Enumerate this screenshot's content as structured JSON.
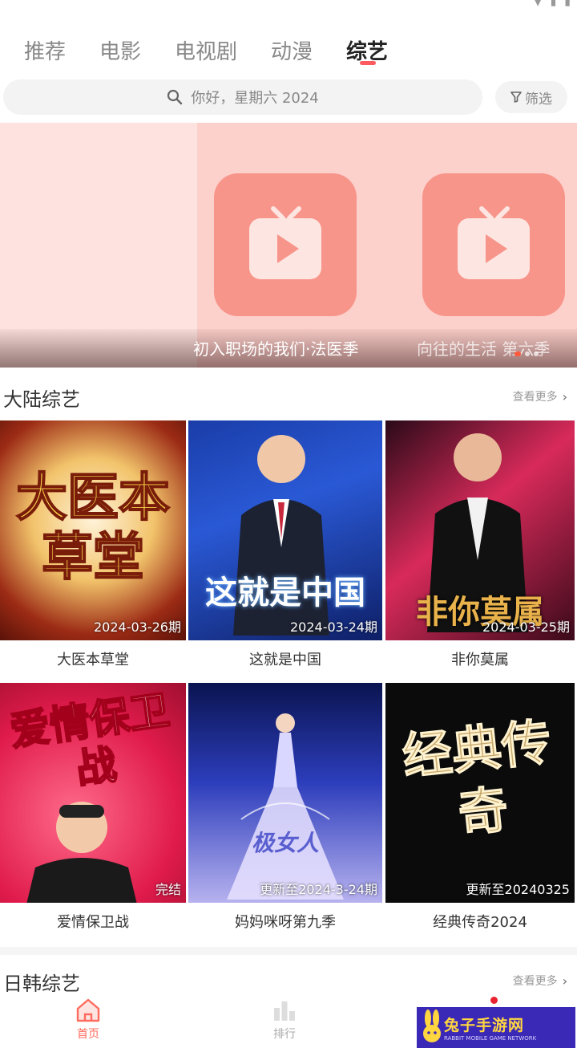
{
  "tabs": [
    {
      "label": "推荐"
    },
    {
      "label": "电影"
    },
    {
      "label": "电视剧"
    },
    {
      "label": "动漫"
    },
    {
      "label": "综艺",
      "active": true
    }
  ],
  "search": {
    "placeholder": "你好，星期六 2024"
  },
  "filter": {
    "label": "筛选"
  },
  "banner": {
    "captions": [
      "初入职场的我们·法医季",
      "向往的生活 第六季"
    ]
  },
  "sections": [
    {
      "title": "大陆综艺",
      "more": "查看更多",
      "items": [
        {
          "name": "大医本草堂",
          "poster_text": "大医本草堂",
          "tag": "2024-03-26期"
        },
        {
          "name": "这就是中国",
          "poster_text": "这就是中国",
          "tag": "2024-03-24期"
        },
        {
          "name": "非你莫属",
          "poster_text": "非你莫属",
          "tag": "2024-03-25期"
        },
        {
          "name": "爱情保卫战",
          "poster_text": "爱情保卫战",
          "tag": "完结"
        },
        {
          "name": "妈妈咪呀第九季",
          "poster_text": "极女人",
          "tag": "更新至2024-3-24期"
        },
        {
          "name": "经典传奇2024",
          "poster_text": "经典传奇",
          "tag": "更新至20240325"
        }
      ]
    },
    {
      "title": "日韩综艺",
      "more": "查看更多"
    }
  ],
  "bottom_nav": [
    {
      "label": "首页",
      "icon": "home-icon",
      "active": true
    },
    {
      "label": "排行",
      "icon": "ranking-icon"
    }
  ],
  "watermark": {
    "main": "兔子手游网",
    "sub": "RABBIT MOBILE GAME NETWORK"
  },
  "colors": {
    "accent": "#ff5a5f",
    "banner_bg": "#fcd0cb",
    "play_tile": "#f8958b"
  }
}
